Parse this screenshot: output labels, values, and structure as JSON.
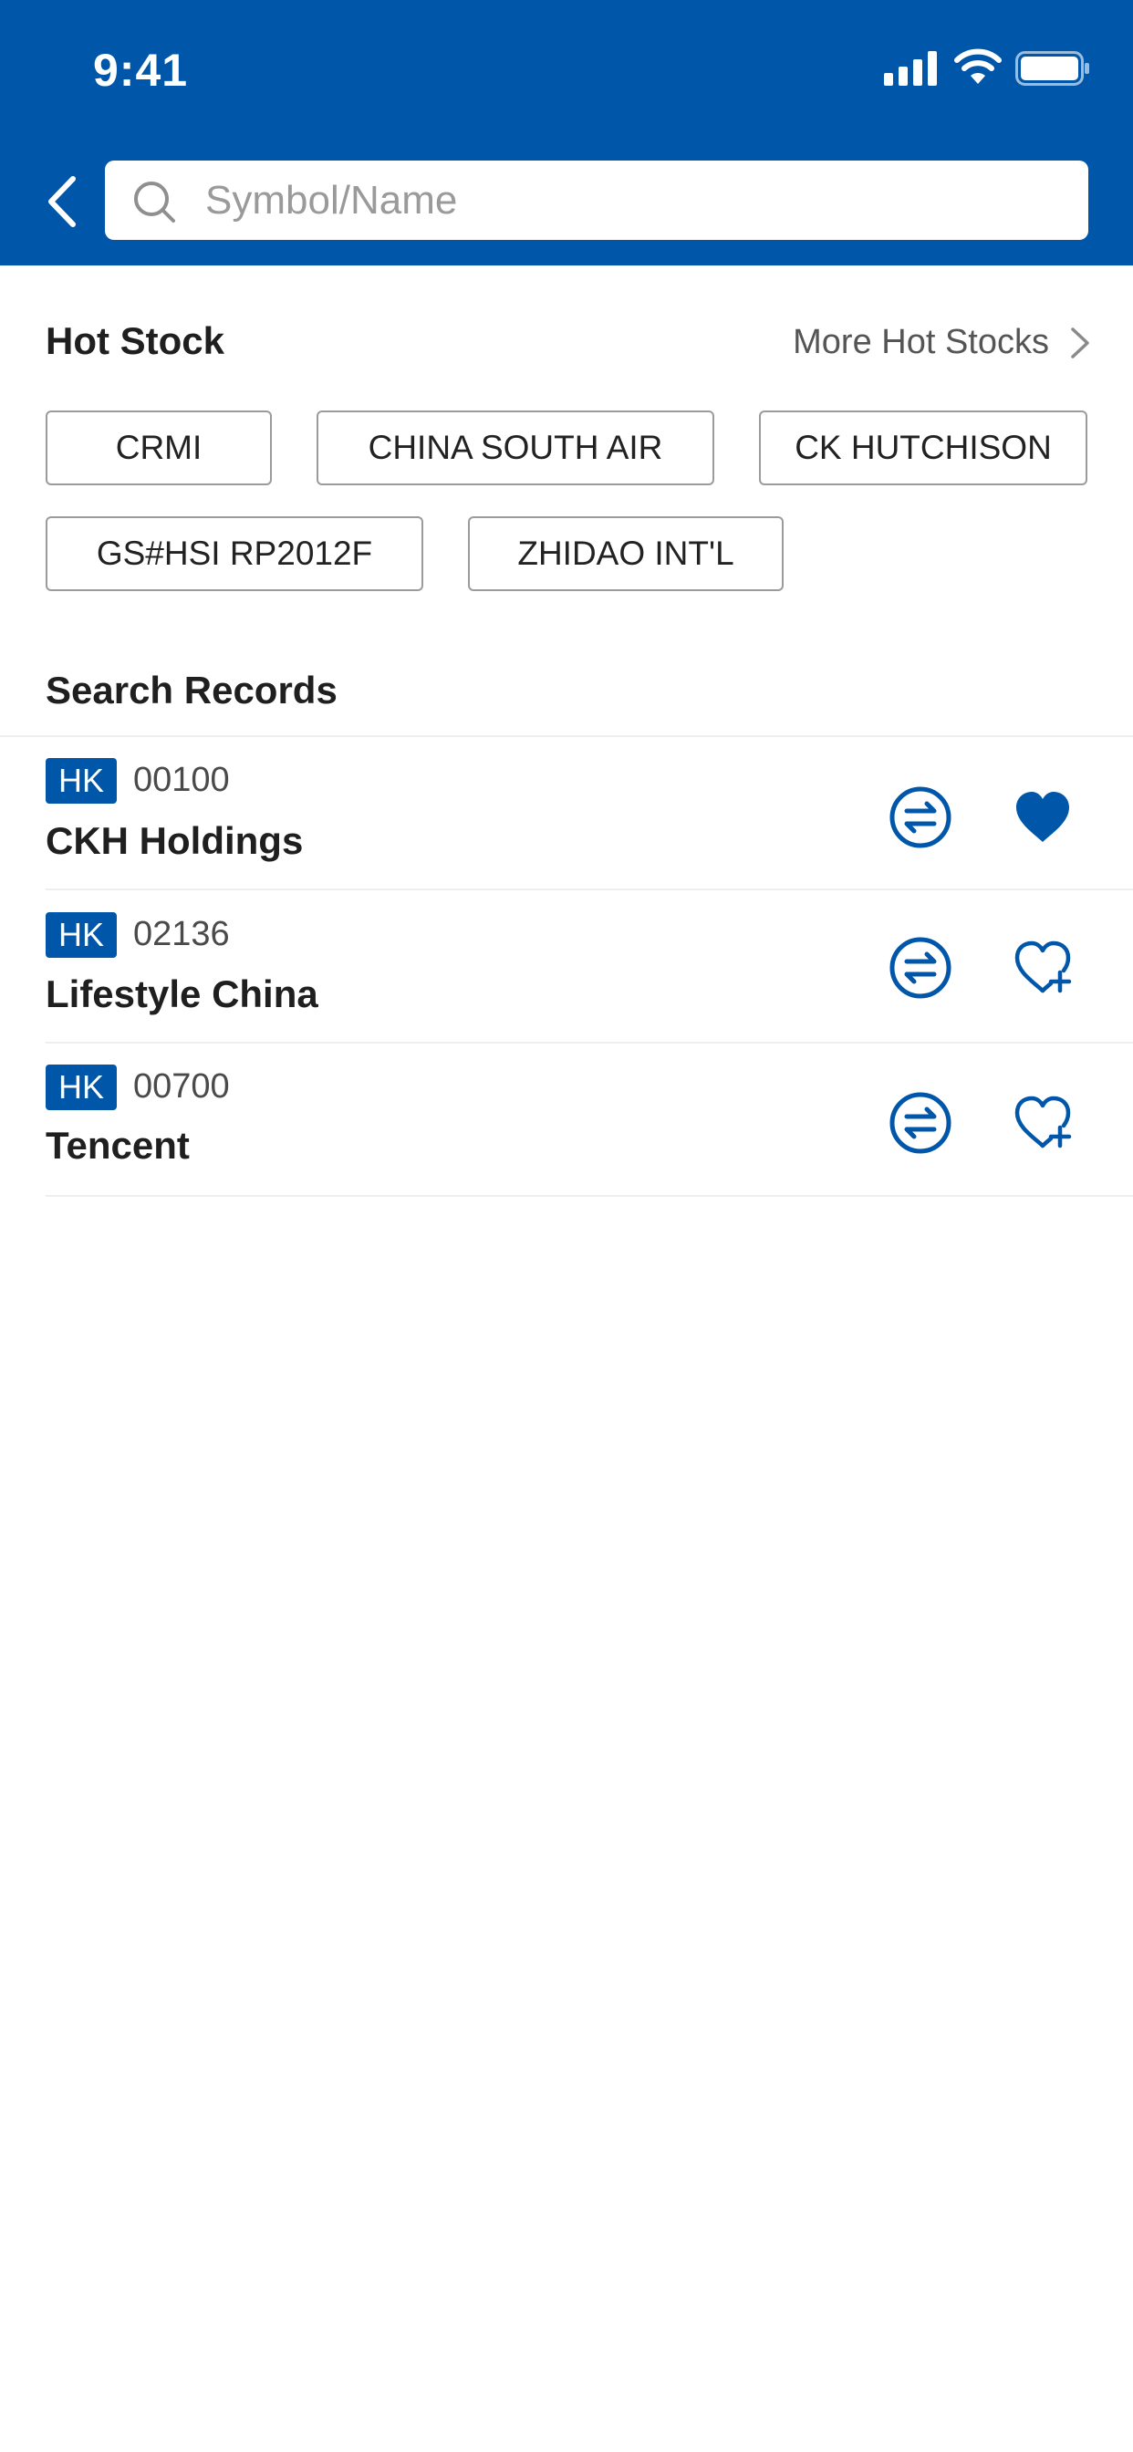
{
  "status_bar": {
    "time": "9:41"
  },
  "search": {
    "placeholder": "Symbol/Name",
    "value": ""
  },
  "hot_stock": {
    "title": "Hot Stock",
    "more_label": "More Hot Stocks",
    "chips": [
      "CRMI",
      "CHINA SOUTH AIR",
      "CK HUTCHISON",
      "GS#HSI RP2012F",
      "ZHIDAO INT'L"
    ]
  },
  "records": {
    "title": "Search Records",
    "items": [
      {
        "market": "HK",
        "code": "00100",
        "name": "CKH Holdings",
        "favorited": true
      },
      {
        "market": "HK",
        "code": "02136",
        "name": "Lifestyle China",
        "favorited": false
      },
      {
        "market": "HK",
        "code": "00700",
        "name": "Tencent",
        "favorited": false
      }
    ]
  },
  "colors": {
    "brand": "#0057aa",
    "chip_border": "#9b9b9b"
  },
  "icons": [
    "back-icon",
    "search-icon",
    "chevron-right-icon",
    "swap-icon",
    "heart-filled-icon",
    "heart-add-icon",
    "signal-icon",
    "wifi-icon",
    "battery-icon"
  ]
}
